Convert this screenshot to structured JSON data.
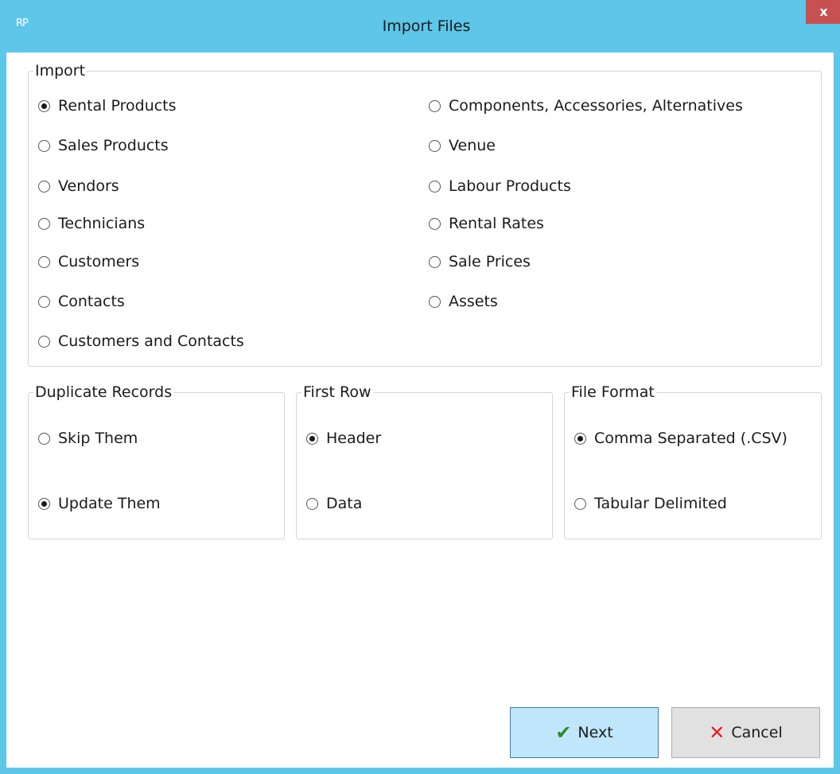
{
  "window": {
    "title": "Import Files",
    "app_icon_text": "RP",
    "close_label": "x",
    "accent_color": "#5dc6e9"
  },
  "import_group": {
    "label": "Import",
    "left_options": [
      {
        "label": "Rental Products",
        "checked": true
      },
      {
        "label": "Sales Products",
        "checked": false
      },
      {
        "label": "Vendors",
        "checked": false
      },
      {
        "label": "Technicians",
        "checked": false
      },
      {
        "label": "Customers",
        "checked": false
      },
      {
        "label": "Contacts",
        "checked": false
      },
      {
        "label": "Customers and Contacts",
        "checked": false
      }
    ],
    "right_options": [
      {
        "label": "Components, Accessories, Alternatives",
        "checked": false
      },
      {
        "label": "Venue",
        "checked": false
      },
      {
        "label": "Labour Products",
        "checked": false
      },
      {
        "label": "Rental Rates",
        "checked": false
      },
      {
        "label": "Sale Prices",
        "checked": false
      },
      {
        "label": "Assets",
        "checked": false
      }
    ]
  },
  "duplicate_group": {
    "label": "Duplicate Records",
    "options": [
      {
        "label": "Skip Them",
        "checked": false
      },
      {
        "label": "Update Them",
        "checked": true
      }
    ]
  },
  "first_row_group": {
    "label": "First Row",
    "options": [
      {
        "label": "Header",
        "checked": true
      },
      {
        "label": "Data",
        "checked": false
      }
    ]
  },
  "file_format_group": {
    "label": "File Format",
    "options": [
      {
        "label": "Comma Separated (.CSV)",
        "checked": true
      },
      {
        "label": "Tabular Delimited",
        "checked": false
      }
    ]
  },
  "buttons": {
    "next_label": "Next",
    "cancel_label": "Cancel",
    "next_icon": "check-icon",
    "cancel_icon": "x-icon"
  }
}
